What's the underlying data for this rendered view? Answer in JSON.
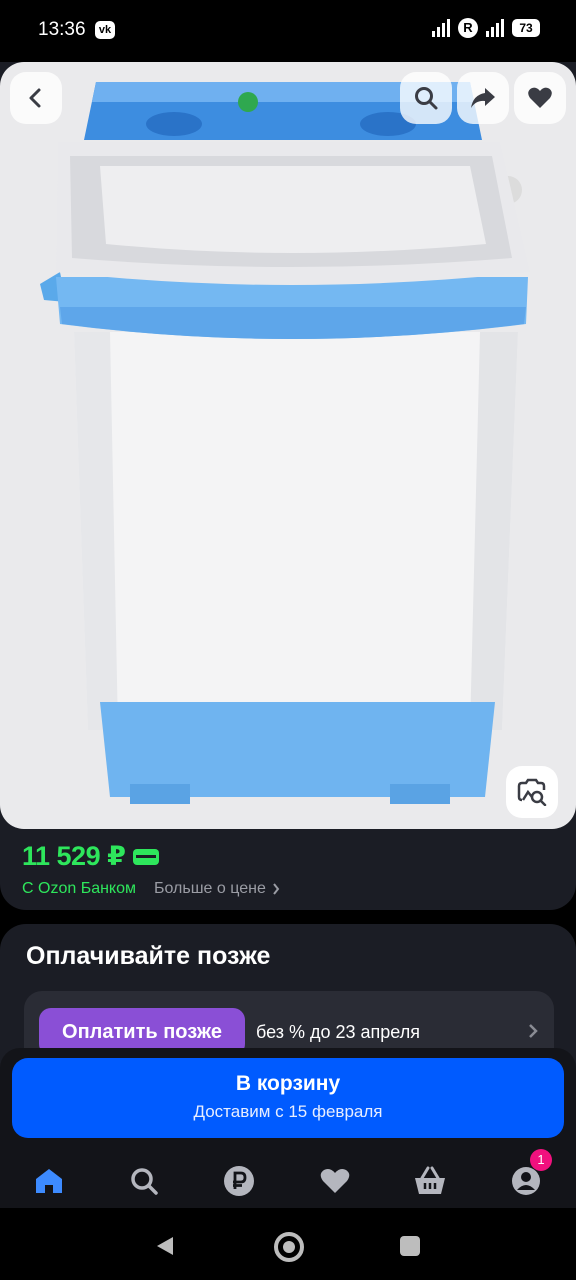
{
  "status_bar": {
    "time": "13:36",
    "vk_label": "vk",
    "r_label": "R",
    "battery": "73"
  },
  "product": {
    "price": "11 529 ₽",
    "bank_label": "С Ozon Банком",
    "more_price": "Больше о цене"
  },
  "pay_later": {
    "title": "Оплачивайте позже",
    "button_label": "Оплатить позже",
    "terms": "без % до 23 апреля"
  },
  "cart": {
    "button_label": "В корзину",
    "delivery": "Доставим с 15 февраля"
  },
  "nav": {
    "items": [
      "home-icon",
      "search-icon",
      "ruble-icon",
      "heart-icon",
      "basket-icon",
      "profile-icon"
    ],
    "profile_badge": "1"
  },
  "colors": {
    "accent": "#005bff",
    "price_green": "#2ee65c",
    "pay_later_purple": "#8a4fd6",
    "badge_pink": "#f1117e",
    "card_bg": "#1b1d25"
  }
}
